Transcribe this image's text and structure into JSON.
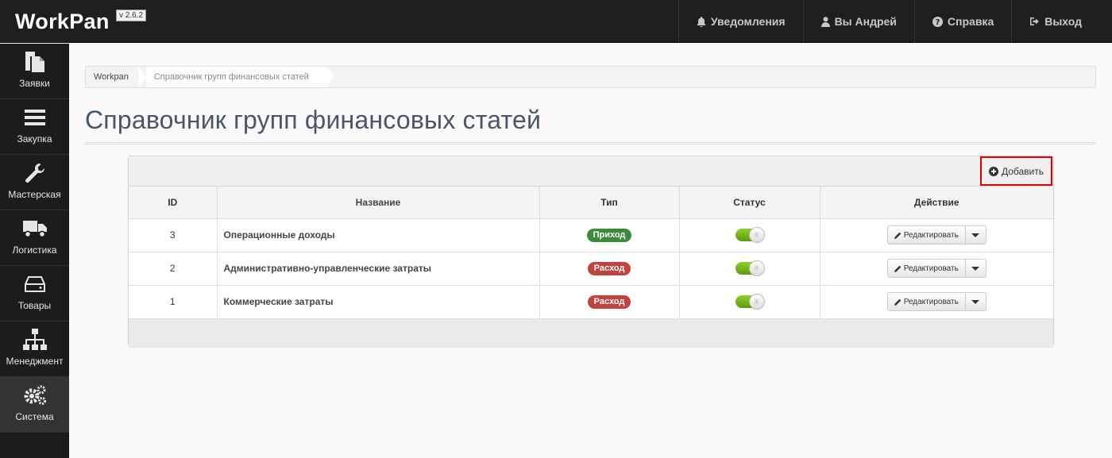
{
  "app": {
    "brand": "WorkPan",
    "version": "v 2.6.2"
  },
  "topnav": [
    {
      "icon": "bell-icon",
      "label": "Уведомления"
    },
    {
      "icon": "user-icon",
      "label": "Вы Андрей"
    },
    {
      "icon": "help-icon",
      "label": "Справка"
    },
    {
      "icon": "logout-icon",
      "label": "Выход"
    }
  ],
  "sidebar": {
    "items": [
      {
        "icon": "documents-icon",
        "label": "Заявки"
      },
      {
        "icon": "bars-icon",
        "label": "Закупка"
      },
      {
        "icon": "wrench-icon",
        "label": "Мастерская"
      },
      {
        "icon": "truck-icon",
        "label": "Логистика"
      },
      {
        "icon": "drive-icon",
        "label": "Товары"
      },
      {
        "icon": "sitemap-icon",
        "label": "Менеджмент"
      },
      {
        "icon": "gears-icon",
        "label": "Система",
        "active": true
      }
    ]
  },
  "breadcrumb": [
    "Workpan",
    "Справочник групп финансовых статей"
  ],
  "page": {
    "title": "Справочник групп финансовых статей"
  },
  "toolbar": {
    "add_label": "Добавить"
  },
  "table": {
    "headers": {
      "id": "ID",
      "name": "Название",
      "type": "Тип",
      "status": "Статус",
      "action": "Действие"
    },
    "rows": [
      {
        "id": "3",
        "name": "Операционные доходы",
        "type": "Приход",
        "type_kind": "in",
        "status_on": true,
        "action_label": "Редактировать"
      },
      {
        "id": "2",
        "name": "Административно-управленческие затраты",
        "type": "Расход",
        "type_kind": "out",
        "status_on": true,
        "action_label": "Редактировать"
      },
      {
        "id": "1",
        "name": "Коммерческие затраты",
        "type": "Расход",
        "type_kind": "out",
        "status_on": true,
        "action_label": "Редактировать"
      }
    ]
  },
  "colors": {
    "income": "#3c8a3c",
    "expense": "#c0433f",
    "highlight": "#e00000",
    "toggle_on": "#7ab820"
  }
}
